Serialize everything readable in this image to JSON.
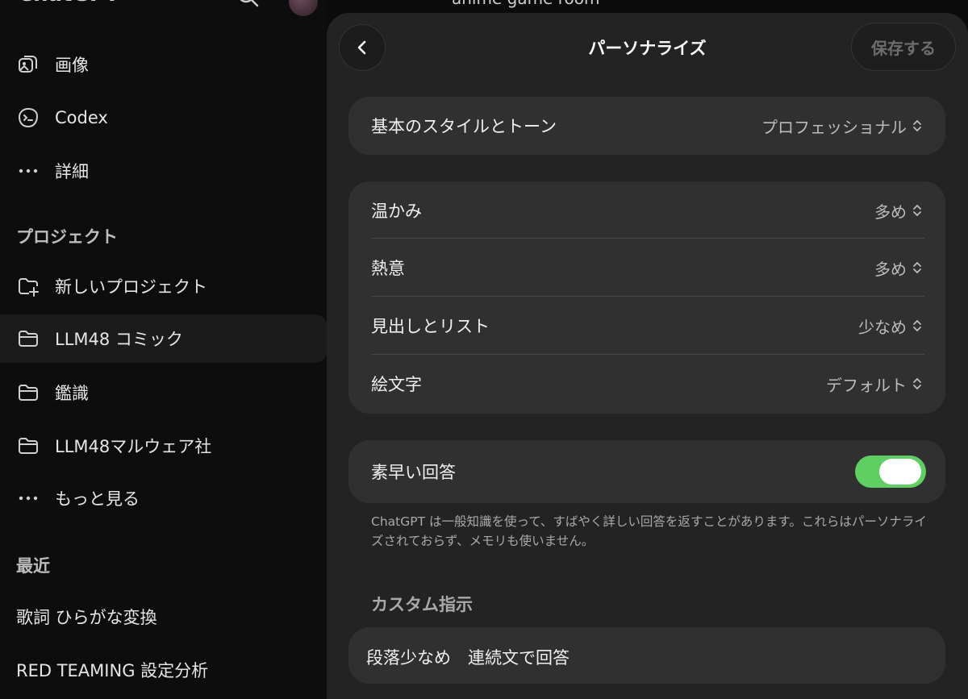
{
  "sidebar": {
    "app_title": "ChatGPT",
    "items_top": [
      {
        "label": "画像",
        "icon": "image-icon"
      },
      {
        "label": "Codex",
        "icon": "codex-icon"
      },
      {
        "label": "詳細",
        "icon": "more-icon"
      }
    ],
    "projects_heading": "プロジェクト",
    "projects": [
      {
        "label": "新しいプロジェクト",
        "icon": "new-folder-icon"
      },
      {
        "label": "LLM48 コミック",
        "icon": "folder-icon",
        "active": true
      },
      {
        "label": "鑑識",
        "icon": "folder-icon"
      },
      {
        "label": "LLM48マルウェア社",
        "icon": "folder-icon"
      },
      {
        "label": "もっと見る",
        "icon": "more-icon"
      }
    ],
    "recent_heading": "最近",
    "recent": [
      {
        "label": "歌詞 ひらがな変換"
      },
      {
        "label": "RED TEAMING 設定分析"
      }
    ]
  },
  "chat": {
    "title_fragment": "anime game room"
  },
  "modal": {
    "title": "パーソナライズ",
    "save_label": "保存する",
    "style_row": {
      "label": "基本のスタイルとトーン",
      "value": "プロフェッショナル"
    },
    "traits": [
      {
        "label": "温かみ",
        "value": "多め"
      },
      {
        "label": "熱意",
        "value": "多め"
      },
      {
        "label": "見出しとリスト",
        "value": "少なめ"
      },
      {
        "label": "絵文字",
        "value": "デフォルト"
      }
    ],
    "quick_answer": {
      "label": "素早い回答",
      "enabled": true
    },
    "help_text": "ChatGPT は一般知識を使って、すばやく詳しい回答を返すことがあります。これらはパーソナライズされておらず、メモリも使いません。",
    "custom_heading": "カスタム指示",
    "custom_instruction": "段落少なめ　連続文で回答"
  },
  "colors": {
    "toggle_on": "#5fcf64",
    "modal_bg": "#232323",
    "card_bg": "#303030",
    "sidebar_bg": "#0d0d0d"
  }
}
